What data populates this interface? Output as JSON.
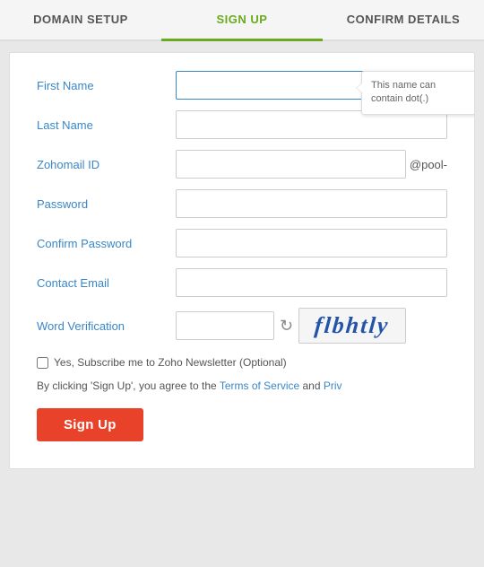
{
  "tabs": [
    {
      "id": "domain-setup",
      "label": "DOMAIN SETUP",
      "active": false
    },
    {
      "id": "sign-up",
      "label": "SIGN UP",
      "active": true
    },
    {
      "id": "confirm-details",
      "label": "CONFIRM DETAILS",
      "active": false
    }
  ],
  "form": {
    "first_name_label": "First Name",
    "last_name_label": "Last Name",
    "zohomail_id_label": "Zohomail ID",
    "zohomail_suffix": "@pool-",
    "password_label": "Password",
    "confirm_password_label": "Confirm Password",
    "contact_email_label": "Contact Email",
    "word_verification_label": "Word Verification",
    "captcha_text": "flbhtly",
    "newsletter_label": "Yes, Subscribe me to Zoho Newsletter (Optional)",
    "terms_text_before": "By clicking 'Sign Up', you agree to the ",
    "terms_link": "Terms of Service",
    "terms_text_mid": " and ",
    "privacy_link": "Priv",
    "signup_button": "Sign Up"
  },
  "tooltip": {
    "text": "This name can contain dot(.)"
  }
}
